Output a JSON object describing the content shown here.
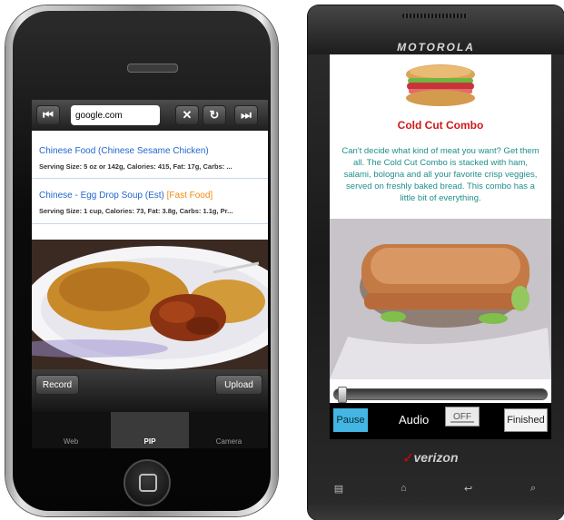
{
  "iphone": {
    "browser": {
      "url": "google.com",
      "buttons": {
        "prev": "⏮",
        "close": "✕",
        "reload": "↻",
        "next": "⏭"
      }
    },
    "results": [
      {
        "title": "Chinese Food (Chinese Sesame Chicken)",
        "tag": "",
        "meta": "Serving Size: 5 oz or 142g, Calories: 415, Fat: 17g, Carbs: ..."
      },
      {
        "title": "Chinese - Egg Drop Soup (Est) ",
        "tag": "[Fast Food]",
        "meta": "Serving Size: 1 cup, Calories: 73, Fat: 3.8g, Carbs: 1.1g, Pr..."
      }
    ],
    "controls": {
      "record": "Record",
      "upload": "Upload"
    },
    "tabs": [
      {
        "label": "Web",
        "active": false
      },
      {
        "label": "PIP",
        "active": true
      },
      {
        "label": "Camera",
        "active": false
      }
    ]
  },
  "android": {
    "brand": "MOTOROLA",
    "card": {
      "title": "Cold Cut Combo",
      "description": "Can't decide what kind of meat you want? Get them all. The Cold Cut Combo is stacked with ham, salami, bologna and all your favorite crisp veggies, served on freshly baked bread. This combo has a little bit of everything."
    },
    "media": {
      "progress": 0.02,
      "pause": "Pause",
      "audio_label": "Audio",
      "audio_toggle": "OFF",
      "finished": "Finished"
    },
    "carrier": "verizon",
    "softkeys": [
      "▤",
      "⌂",
      "↩",
      "⌕"
    ]
  },
  "colors": {
    "link": "#2266cc",
    "tag": "#f08a10",
    "title_red": "#d01818",
    "desc_teal": "#1f8f8c",
    "pause_blue": "#43b6e3"
  }
}
